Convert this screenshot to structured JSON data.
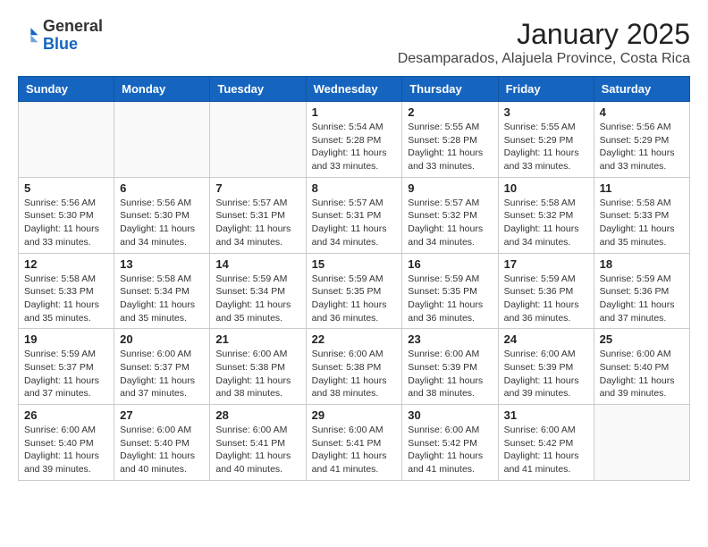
{
  "header": {
    "logo": {
      "general": "General",
      "blue": "Blue"
    },
    "title": "January 2025",
    "location": "Desamparados, Alajuela Province, Costa Rica"
  },
  "weekdays": [
    "Sunday",
    "Monday",
    "Tuesday",
    "Wednesday",
    "Thursday",
    "Friday",
    "Saturday"
  ],
  "weeks": [
    [
      {
        "day": "",
        "info": ""
      },
      {
        "day": "",
        "info": ""
      },
      {
        "day": "",
        "info": ""
      },
      {
        "day": "1",
        "info": "Sunrise: 5:54 AM\nSunset: 5:28 PM\nDaylight: 11 hours\nand 33 minutes."
      },
      {
        "day": "2",
        "info": "Sunrise: 5:55 AM\nSunset: 5:28 PM\nDaylight: 11 hours\nand 33 minutes."
      },
      {
        "day": "3",
        "info": "Sunrise: 5:55 AM\nSunset: 5:29 PM\nDaylight: 11 hours\nand 33 minutes."
      },
      {
        "day": "4",
        "info": "Sunrise: 5:56 AM\nSunset: 5:29 PM\nDaylight: 11 hours\nand 33 minutes."
      }
    ],
    [
      {
        "day": "5",
        "info": "Sunrise: 5:56 AM\nSunset: 5:30 PM\nDaylight: 11 hours\nand 33 minutes."
      },
      {
        "day": "6",
        "info": "Sunrise: 5:56 AM\nSunset: 5:30 PM\nDaylight: 11 hours\nand 34 minutes."
      },
      {
        "day": "7",
        "info": "Sunrise: 5:57 AM\nSunset: 5:31 PM\nDaylight: 11 hours\nand 34 minutes."
      },
      {
        "day": "8",
        "info": "Sunrise: 5:57 AM\nSunset: 5:31 PM\nDaylight: 11 hours\nand 34 minutes."
      },
      {
        "day": "9",
        "info": "Sunrise: 5:57 AM\nSunset: 5:32 PM\nDaylight: 11 hours\nand 34 minutes."
      },
      {
        "day": "10",
        "info": "Sunrise: 5:58 AM\nSunset: 5:32 PM\nDaylight: 11 hours\nand 34 minutes."
      },
      {
        "day": "11",
        "info": "Sunrise: 5:58 AM\nSunset: 5:33 PM\nDaylight: 11 hours\nand 35 minutes."
      }
    ],
    [
      {
        "day": "12",
        "info": "Sunrise: 5:58 AM\nSunset: 5:33 PM\nDaylight: 11 hours\nand 35 minutes."
      },
      {
        "day": "13",
        "info": "Sunrise: 5:58 AM\nSunset: 5:34 PM\nDaylight: 11 hours\nand 35 minutes."
      },
      {
        "day": "14",
        "info": "Sunrise: 5:59 AM\nSunset: 5:34 PM\nDaylight: 11 hours\nand 35 minutes."
      },
      {
        "day": "15",
        "info": "Sunrise: 5:59 AM\nSunset: 5:35 PM\nDaylight: 11 hours\nand 36 minutes."
      },
      {
        "day": "16",
        "info": "Sunrise: 5:59 AM\nSunset: 5:35 PM\nDaylight: 11 hours\nand 36 minutes."
      },
      {
        "day": "17",
        "info": "Sunrise: 5:59 AM\nSunset: 5:36 PM\nDaylight: 11 hours\nand 36 minutes."
      },
      {
        "day": "18",
        "info": "Sunrise: 5:59 AM\nSunset: 5:36 PM\nDaylight: 11 hours\nand 37 minutes."
      }
    ],
    [
      {
        "day": "19",
        "info": "Sunrise: 5:59 AM\nSunset: 5:37 PM\nDaylight: 11 hours\nand 37 minutes."
      },
      {
        "day": "20",
        "info": "Sunrise: 6:00 AM\nSunset: 5:37 PM\nDaylight: 11 hours\nand 37 minutes."
      },
      {
        "day": "21",
        "info": "Sunrise: 6:00 AM\nSunset: 5:38 PM\nDaylight: 11 hours\nand 38 minutes."
      },
      {
        "day": "22",
        "info": "Sunrise: 6:00 AM\nSunset: 5:38 PM\nDaylight: 11 hours\nand 38 minutes."
      },
      {
        "day": "23",
        "info": "Sunrise: 6:00 AM\nSunset: 5:39 PM\nDaylight: 11 hours\nand 38 minutes."
      },
      {
        "day": "24",
        "info": "Sunrise: 6:00 AM\nSunset: 5:39 PM\nDaylight: 11 hours\nand 39 minutes."
      },
      {
        "day": "25",
        "info": "Sunrise: 6:00 AM\nSunset: 5:40 PM\nDaylight: 11 hours\nand 39 minutes."
      }
    ],
    [
      {
        "day": "26",
        "info": "Sunrise: 6:00 AM\nSunset: 5:40 PM\nDaylight: 11 hours\nand 39 minutes."
      },
      {
        "day": "27",
        "info": "Sunrise: 6:00 AM\nSunset: 5:40 PM\nDaylight: 11 hours\nand 40 minutes."
      },
      {
        "day": "28",
        "info": "Sunrise: 6:00 AM\nSunset: 5:41 PM\nDaylight: 11 hours\nand 40 minutes."
      },
      {
        "day": "29",
        "info": "Sunrise: 6:00 AM\nSunset: 5:41 PM\nDaylight: 11 hours\nand 41 minutes."
      },
      {
        "day": "30",
        "info": "Sunrise: 6:00 AM\nSunset: 5:42 PM\nDaylight: 11 hours\nand 41 minutes."
      },
      {
        "day": "31",
        "info": "Sunrise: 6:00 AM\nSunset: 5:42 PM\nDaylight: 11 hours\nand 41 minutes."
      },
      {
        "day": "",
        "info": ""
      }
    ]
  ]
}
